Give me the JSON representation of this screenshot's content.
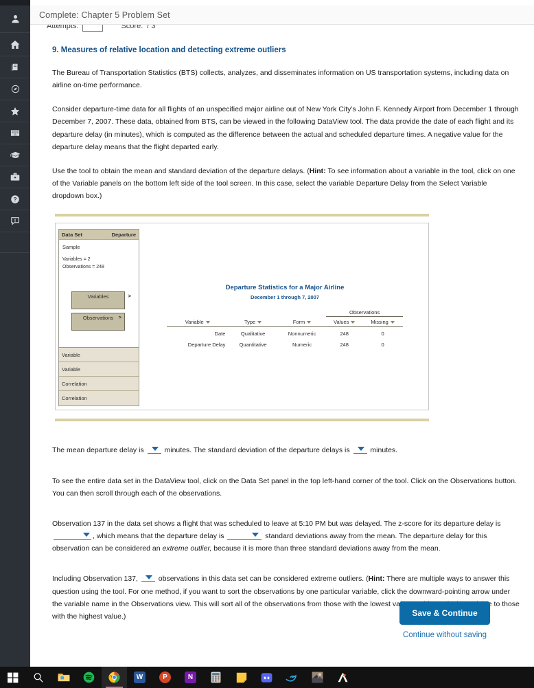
{
  "titlebar": {
    "title": "Complete: Chapter 5 Problem Set"
  },
  "attempts": {
    "attempts_label": "Attempts:",
    "attempts_value": "",
    "score_label": "Score:",
    "score_value": "/ 3"
  },
  "rail": {
    "items": [
      {
        "name": "account-icon",
        "label": "Account"
      },
      {
        "name": "home-icon",
        "label": "Home"
      },
      {
        "name": "book-icon",
        "label": "Course"
      },
      {
        "name": "compass-icon",
        "label": "Explore"
      },
      {
        "name": "star-icon",
        "label": "Favorites"
      },
      {
        "name": "open-book-icon",
        "label": "eBook"
      },
      {
        "name": "graduation-cap-icon",
        "label": "Grades"
      },
      {
        "name": "briefcase-icon",
        "label": "Resources"
      },
      {
        "name": "help-icon",
        "label": "Help"
      },
      {
        "name": "feedback-icon",
        "label": "Feedback"
      }
    ]
  },
  "question": {
    "number_title": "9. Measures of relative location and detecting extreme outliers",
    "p1": "The Bureau of Transportation Statistics (BTS) collects, analyzes, and disseminates information on US transportation systems, including data on airline on-time performance.",
    "p2": "Consider departure-time data for all flights of an unspecified major airline out of New York City’s John F. Kennedy Airport from December 1 through December 7, 2007. These data, obtained from BTS, can be viewed in the following DataView tool. The data provide the date of each flight and its departure delay (in minutes), which is computed as the difference between the actual and scheduled departure times. A negative value for the departure delay means that the flight departed early.",
    "p3_a": "Use the tool to obtain the mean and standard deviation of the departure delays. (",
    "p3_hint": "Hint:",
    "p3_b": " To see information about a variable in the tool, click on one of the Variable panels on the bottom left side of the tool screen. In this case, select the variable Departure Delay from the Select Variable dropdown box.)",
    "q_mean_a": "The mean departure delay is",
    "q_mean_b": "minutes. The standard deviation of the departure delays is",
    "q_mean_c": "minutes.",
    "p4": "To see the entire data set in the DataView tool, click on the Data Set panel in the top left-hand corner of the tool. Click on the Observations button. You can then scroll through each of the observations.",
    "q_obs_a": "Observation 137 in the data set shows a flight that was scheduled to leave at 5:10 PM but was delayed. The z-score for its departure delay is",
    "q_obs_b": ", which means that the departure delay is",
    "q_obs_c": "standard deviations away from the mean. The departure delay for this observation can be considered an",
    "q_obs_italic": "extreme outlier,",
    "q_obs_d": " because it is more than three standard deviations away from the mean.",
    "q_out_a": "Including Observation 137,",
    "q_out_b": "observations in this data set can be considered extreme outliers. (",
    "q_out_hint": "Hint:",
    "q_out_c": " There are multiple ways to answer this question using the tool. For one method, if you want to sort the observations by one particular variable, click the downward-pointing arrow under the variable name in the Observations view. This will sort all of the observations from those with the lowest value on this particular variable to those with the highest value.)"
  },
  "tool": {
    "dataset_panel": {
      "header_left": "Data Set",
      "header_right": "Departure",
      "sample": "Sample",
      "variables_line": "Variables = 2",
      "observations_line": "Observations = 248",
      "variables_button": "Variables",
      "observations_button": "Observations",
      "chevron": ">"
    },
    "bottom_panels": [
      "Variable",
      "Variable",
      "Correlation",
      "Correlation"
    ],
    "stats": {
      "title": "Departure Statistics for a Major Airline",
      "subtitle": "December 1 through 7, 2007",
      "observations_group": "Observations",
      "columns": [
        "Variable",
        "Type",
        "Form",
        "Values",
        "Missing"
      ],
      "rows": [
        {
          "variable": "Date",
          "type": "Qualitative",
          "form": "Nonnumeric",
          "values": "248",
          "missing": "0"
        },
        {
          "variable": "Departure Delay",
          "type": "Quantitative",
          "form": "Numeric",
          "values": "248",
          "missing": "0"
        }
      ]
    }
  },
  "footer": {
    "save_label": "Save & Continue",
    "skip_label": "Continue without saving"
  },
  "taskbar": {
    "items": [
      {
        "name": "windows-start-icon",
        "label": "Start"
      },
      {
        "name": "search-icon",
        "label": "Search"
      },
      {
        "name": "file-explorer-icon",
        "label": "File Explorer"
      },
      {
        "name": "spotify-icon",
        "label": "Spotify"
      },
      {
        "name": "chrome-icon",
        "label": "Google Chrome"
      },
      {
        "name": "word-icon",
        "label": "W"
      },
      {
        "name": "powerpoint-icon",
        "label": "P"
      },
      {
        "name": "onenote-icon",
        "label": "N"
      },
      {
        "name": "calculator-icon",
        "label": "Calculator"
      },
      {
        "name": "sticky-notes-icon",
        "label": "Sticky Notes"
      },
      {
        "name": "discord-icon",
        "label": "Discord"
      },
      {
        "name": "dolphin-icon",
        "label": "Dolphin"
      },
      {
        "name": "game-icon",
        "label": "Game"
      },
      {
        "name": "autodesk-icon",
        "label": "A"
      }
    ]
  },
  "colors": {
    "accent_blue": "#0b6ca8",
    "heading_blue": "#14518a",
    "gold_rule": "#dacfa1",
    "panel_header": "#cfc8ad",
    "rail_bg": "#2b3137"
  }
}
